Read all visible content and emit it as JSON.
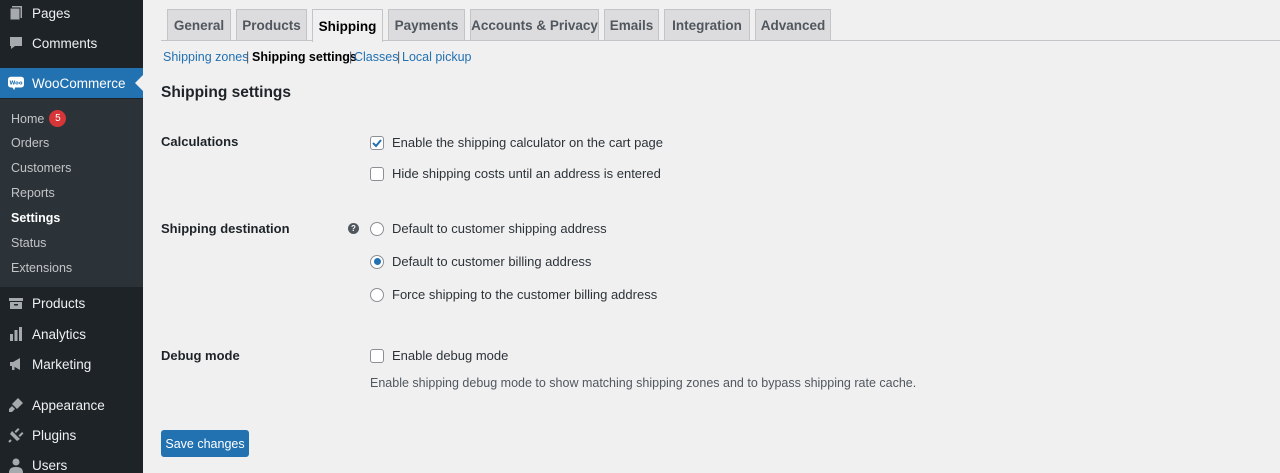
{
  "sidebar": {
    "top_items": [
      {
        "label": "Pages",
        "icon": "pages-icon"
      },
      {
        "label": "Comments",
        "icon": "comments-icon"
      }
    ],
    "woocommerce": {
      "label": "WooCommerce",
      "icon": "woocommerce-icon",
      "logo_text": "Woo"
    },
    "submenu": [
      {
        "label": "Home",
        "badge": "5"
      },
      {
        "label": "Orders"
      },
      {
        "label": "Customers"
      },
      {
        "label": "Reports"
      },
      {
        "label": "Settings",
        "current": true
      },
      {
        "label": "Status"
      },
      {
        "label": "Extensions"
      }
    ],
    "bottom_items": [
      {
        "label": "Products",
        "icon": "products-icon"
      },
      {
        "label": "Analytics",
        "icon": "analytics-icon"
      },
      {
        "label": "Marketing",
        "icon": "marketing-icon"
      },
      {
        "label": "Appearance",
        "icon": "appearance-icon"
      },
      {
        "label": "Plugins",
        "icon": "plugins-icon"
      },
      {
        "label": "Users",
        "icon": "users-icon"
      }
    ]
  },
  "tabs": [
    "General",
    "Products",
    "Shipping",
    "Payments",
    "Accounts & Privacy",
    "Emails",
    "Integration",
    "Advanced"
  ],
  "active_tab": "Shipping",
  "subnav": {
    "items": [
      "Shipping zones",
      "Shipping settings",
      "Classes",
      "Local pickup"
    ],
    "separator": "|",
    "current": "Shipping settings"
  },
  "heading": "Shipping settings",
  "calculations": {
    "label": "Calculations",
    "options": [
      {
        "label": "Enable the shipping calculator on the cart page",
        "checked": true
      },
      {
        "label": "Hide shipping costs until an address is entered",
        "checked": false
      }
    ]
  },
  "destination": {
    "label": "Shipping destination",
    "help_glyph": "?",
    "options": [
      {
        "label": "Default to customer shipping address",
        "selected": false
      },
      {
        "label": "Default to customer billing address",
        "selected": true
      },
      {
        "label": "Force shipping to the customer billing address",
        "selected": false
      }
    ]
  },
  "debug": {
    "label": "Debug mode",
    "option": {
      "label": "Enable debug mode",
      "checked": false
    },
    "description": "Enable shipping debug mode to show matching shipping zones and to bypass shipping rate cache."
  },
  "save_button": "Save changes",
  "colors": {
    "accent": "#2271b1",
    "sidebar_bg": "#1d2327",
    "submenu_bg": "#2c3338",
    "badge": "#d63638",
    "page_bg": "#f0f0f1"
  }
}
